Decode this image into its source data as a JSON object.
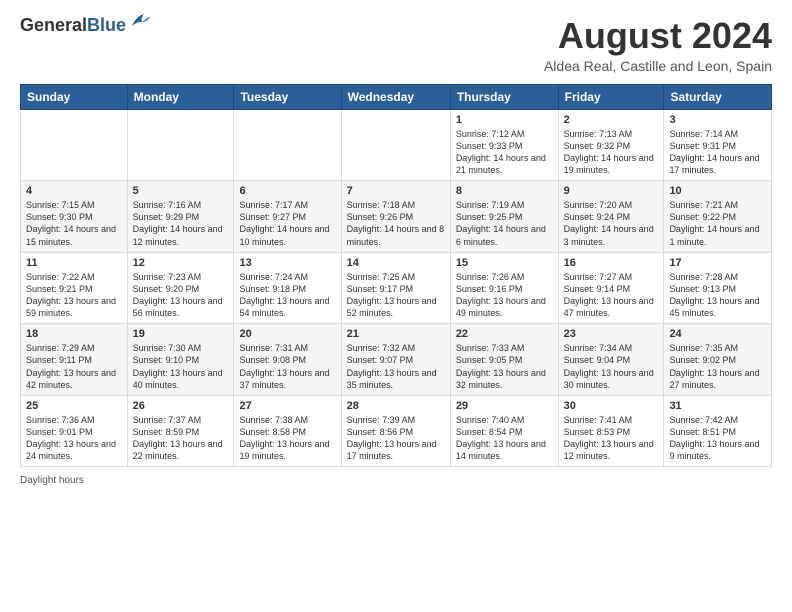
{
  "logo": {
    "general": "General",
    "blue": "Blue"
  },
  "title": {
    "main": "August 2024",
    "sub": "Aldea Real, Castille and Leon, Spain"
  },
  "days_of_week": [
    "Sunday",
    "Monday",
    "Tuesday",
    "Wednesday",
    "Thursday",
    "Friday",
    "Saturday"
  ],
  "weeks": [
    [
      {
        "day": "",
        "info": ""
      },
      {
        "day": "",
        "info": ""
      },
      {
        "day": "",
        "info": ""
      },
      {
        "day": "",
        "info": ""
      },
      {
        "day": "1",
        "info": "Sunrise: 7:12 AM\nSunset: 9:33 PM\nDaylight: 14 hours and 21 minutes."
      },
      {
        "day": "2",
        "info": "Sunrise: 7:13 AM\nSunset: 9:32 PM\nDaylight: 14 hours and 19 minutes."
      },
      {
        "day": "3",
        "info": "Sunrise: 7:14 AM\nSunset: 9:31 PM\nDaylight: 14 hours and 17 minutes."
      }
    ],
    [
      {
        "day": "4",
        "info": "Sunrise: 7:15 AM\nSunset: 9:30 PM\nDaylight: 14 hours and 15 minutes."
      },
      {
        "day": "5",
        "info": "Sunrise: 7:16 AM\nSunset: 9:29 PM\nDaylight: 14 hours and 12 minutes."
      },
      {
        "day": "6",
        "info": "Sunrise: 7:17 AM\nSunset: 9:27 PM\nDaylight: 14 hours and 10 minutes."
      },
      {
        "day": "7",
        "info": "Sunrise: 7:18 AM\nSunset: 9:26 PM\nDaylight: 14 hours and 8 minutes."
      },
      {
        "day": "8",
        "info": "Sunrise: 7:19 AM\nSunset: 9:25 PM\nDaylight: 14 hours and 6 minutes."
      },
      {
        "day": "9",
        "info": "Sunrise: 7:20 AM\nSunset: 9:24 PM\nDaylight: 14 hours and 3 minutes."
      },
      {
        "day": "10",
        "info": "Sunrise: 7:21 AM\nSunset: 9:22 PM\nDaylight: 14 hours and 1 minute."
      }
    ],
    [
      {
        "day": "11",
        "info": "Sunrise: 7:22 AM\nSunset: 9:21 PM\nDaylight: 13 hours and 59 minutes."
      },
      {
        "day": "12",
        "info": "Sunrise: 7:23 AM\nSunset: 9:20 PM\nDaylight: 13 hours and 56 minutes."
      },
      {
        "day": "13",
        "info": "Sunrise: 7:24 AM\nSunset: 9:18 PM\nDaylight: 13 hours and 54 minutes."
      },
      {
        "day": "14",
        "info": "Sunrise: 7:25 AM\nSunset: 9:17 PM\nDaylight: 13 hours and 52 minutes."
      },
      {
        "day": "15",
        "info": "Sunrise: 7:26 AM\nSunset: 9:16 PM\nDaylight: 13 hours and 49 minutes."
      },
      {
        "day": "16",
        "info": "Sunrise: 7:27 AM\nSunset: 9:14 PM\nDaylight: 13 hours and 47 minutes."
      },
      {
        "day": "17",
        "info": "Sunrise: 7:28 AM\nSunset: 9:13 PM\nDaylight: 13 hours and 45 minutes."
      }
    ],
    [
      {
        "day": "18",
        "info": "Sunrise: 7:29 AM\nSunset: 9:11 PM\nDaylight: 13 hours and 42 minutes."
      },
      {
        "day": "19",
        "info": "Sunrise: 7:30 AM\nSunset: 9:10 PM\nDaylight: 13 hours and 40 minutes."
      },
      {
        "day": "20",
        "info": "Sunrise: 7:31 AM\nSunset: 9:08 PM\nDaylight: 13 hours and 37 minutes."
      },
      {
        "day": "21",
        "info": "Sunrise: 7:32 AM\nSunset: 9:07 PM\nDaylight: 13 hours and 35 minutes."
      },
      {
        "day": "22",
        "info": "Sunrise: 7:33 AM\nSunset: 9:05 PM\nDaylight: 13 hours and 32 minutes."
      },
      {
        "day": "23",
        "info": "Sunrise: 7:34 AM\nSunset: 9:04 PM\nDaylight: 13 hours and 30 minutes."
      },
      {
        "day": "24",
        "info": "Sunrise: 7:35 AM\nSunset: 9:02 PM\nDaylight: 13 hours and 27 minutes."
      }
    ],
    [
      {
        "day": "25",
        "info": "Sunrise: 7:36 AM\nSunset: 9:01 PM\nDaylight: 13 hours and 24 minutes."
      },
      {
        "day": "26",
        "info": "Sunrise: 7:37 AM\nSunset: 8:59 PM\nDaylight: 13 hours and 22 minutes."
      },
      {
        "day": "27",
        "info": "Sunrise: 7:38 AM\nSunset: 8:58 PM\nDaylight: 13 hours and 19 minutes."
      },
      {
        "day": "28",
        "info": "Sunrise: 7:39 AM\nSunset: 8:56 PM\nDaylight: 13 hours and 17 minutes."
      },
      {
        "day": "29",
        "info": "Sunrise: 7:40 AM\nSunset: 8:54 PM\nDaylight: 13 hours and 14 minutes."
      },
      {
        "day": "30",
        "info": "Sunrise: 7:41 AM\nSunset: 8:53 PM\nDaylight: 13 hours and 12 minutes."
      },
      {
        "day": "31",
        "info": "Sunrise: 7:42 AM\nSunset: 8:51 PM\nDaylight: 13 hours and 9 minutes."
      }
    ]
  ],
  "footer": {
    "daylight_label": "Daylight hours"
  }
}
